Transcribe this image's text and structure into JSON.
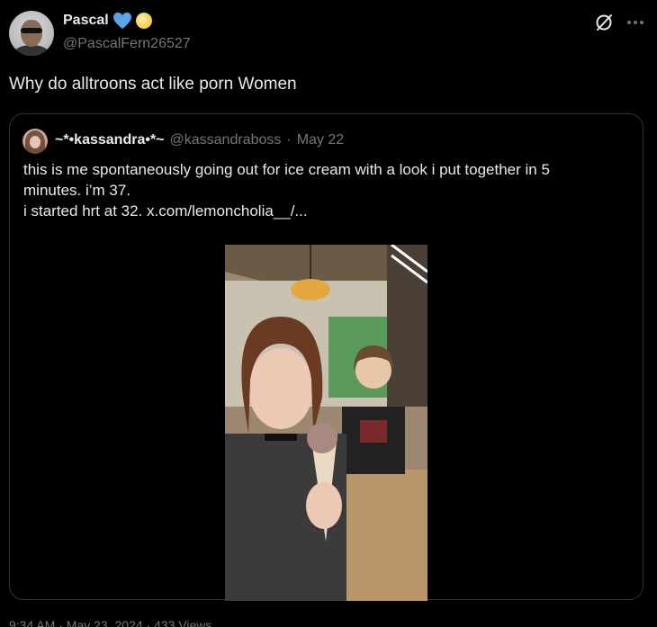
{
  "author": {
    "display_name": "Pascal",
    "handle": "@PascalFern26527",
    "badges": [
      "blue-heart-icon",
      "gold-circle-icon"
    ]
  },
  "tweet": {
    "text": "Why do alltroons act like porn Women"
  },
  "quoted": {
    "display_name": "~*•kassandra•*~",
    "handle": "@kassandraboss",
    "separator": "·",
    "date": "May 22",
    "text_lines": [
      "this is me spontaneously going out for ice cream with a look i put together in 5",
      "minutes. i’m 37.",
      "i started hrt at 32.  x.com/lemoncholia__/..."
    ],
    "media": {
      "kind": "photo"
    }
  },
  "footer": {
    "partial": "9:34 AM · May 23, 2024 · 433 Views"
  },
  "colors": {
    "background": "#000000",
    "text": "#e7e9ea",
    "muted": "#71767b",
    "border": "#2f3336",
    "heart": "#5ba4e8"
  },
  "icons": {
    "grok": "grok-icon",
    "more": "more-icon"
  }
}
